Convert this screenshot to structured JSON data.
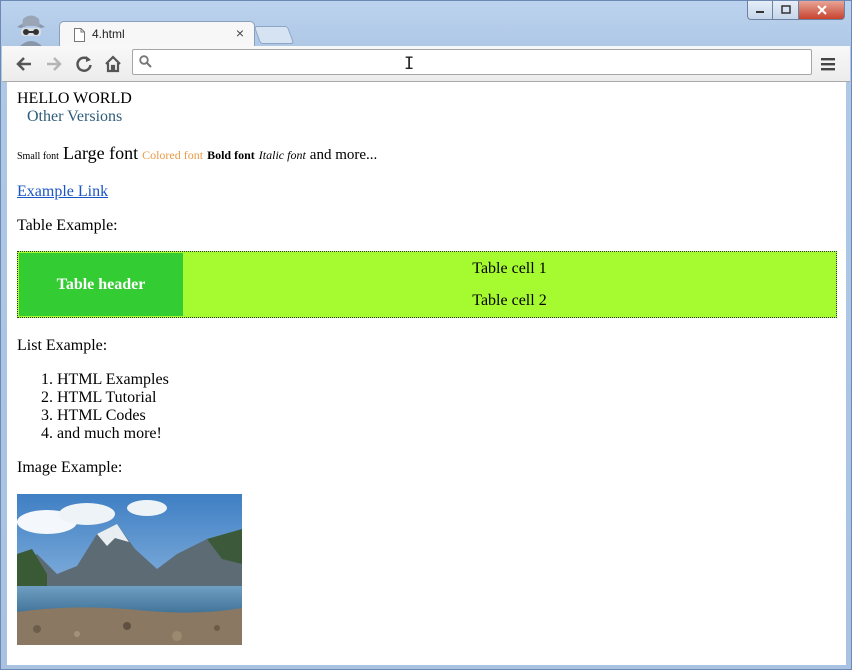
{
  "browser": {
    "tab_title": "4.html",
    "tab_close": "×",
    "omnibox_placeholder": "",
    "incognito": "incognito-icon"
  },
  "page": {
    "hello": "HELLO WORLD",
    "other_versions": "Other Versions",
    "fonts": {
      "small": "Small font",
      "large": "Large font",
      "colored": "Colored font",
      "bold": "Bold font",
      "italic": "Italic font",
      "more": "and more..."
    },
    "link_text": "Example Link",
    "table_label": "Table Example:",
    "table": {
      "header": "Table header",
      "cells": [
        "Table cell 1",
        "Table cell 2"
      ]
    },
    "list_label": "List Example:",
    "list_items": [
      "HTML Examples",
      "HTML Tutorial",
      "HTML Codes",
      "and much more!"
    ],
    "image_label": "Image Example:"
  },
  "colors": {
    "table_header_bg": "#33cc33",
    "table_cell_bg": "#a5fb2f",
    "colored_font": "#e89c45",
    "other_versions": "#2f5c7a",
    "link": "#1a55c4"
  }
}
